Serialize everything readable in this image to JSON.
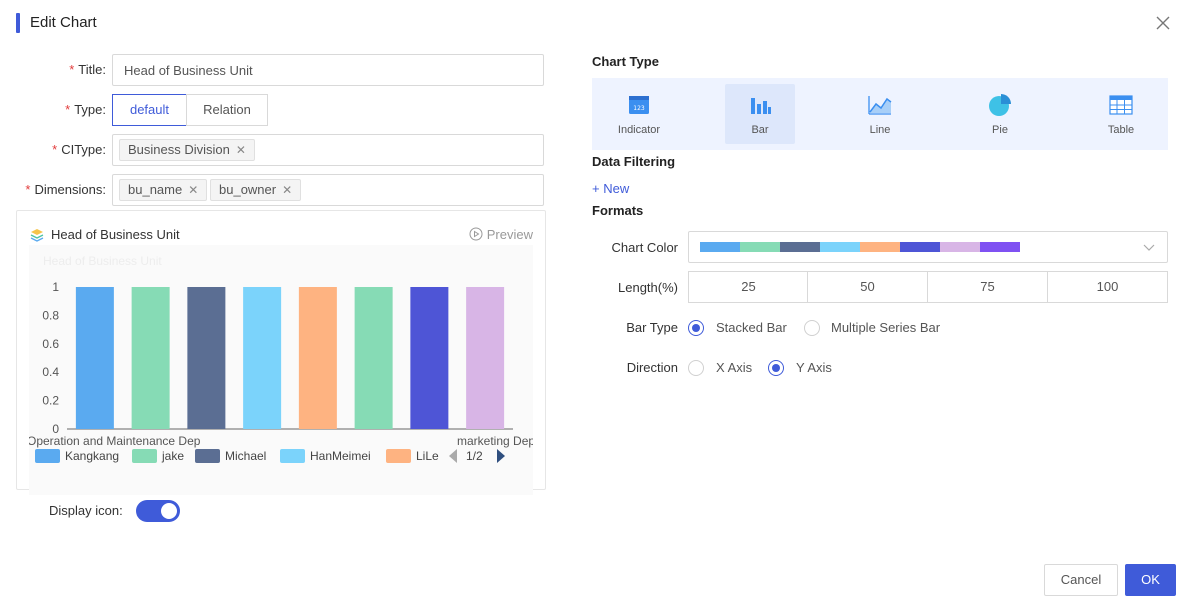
{
  "dialog": {
    "title": "Edit Chart"
  },
  "form": {
    "title_label": "Title",
    "title_value": "Head of Business Unit",
    "type_label": "Type",
    "type_options": [
      "default",
      "Relation"
    ],
    "citype_label": "CIType",
    "citype_tags": [
      "Business Division"
    ],
    "dimensions_label": "Dimensions",
    "dimension_tags": [
      "bu_name",
      "bu_owner"
    ],
    "display_icon_label": "Display icon",
    "display_icon_on": true
  },
  "preview": {
    "title": "Head of Business Unit",
    "preview_label": "Preview"
  },
  "chart_data": {
    "type": "bar",
    "watermark_title": "Head of Business Unit",
    "x_tick_labels": [
      "Operation and Maintenance Dep",
      "marketing Dep"
    ],
    "ylim": [
      0,
      1
    ],
    "yticks": [
      "0",
      "0.2",
      "0.4",
      "0.6",
      "0.8",
      "1"
    ],
    "series": [
      {
        "name": "Kangkang",
        "value": 1,
        "color": "#5aaaf0"
      },
      {
        "name": "jake",
        "value": 1,
        "color": "#86dbb5"
      },
      {
        "name": "Michael",
        "value": 1,
        "color": "#5b6e93"
      },
      {
        "name": "HanMeimei",
        "value": 1,
        "color": "#7bd3fb"
      },
      {
        "name": "LiLei",
        "value": 1,
        "color": "#feb381"
      },
      {
        "name": "",
        "value": 1,
        "color": "#86dbb5"
      },
      {
        "name": "",
        "value": 1,
        "color": "#4e55d6"
      },
      {
        "name": "",
        "value": 1,
        "color": "#d8b5e6"
      }
    ],
    "legend_visible": [
      "Kangkang",
      "jake",
      "Michael",
      "HanMeimei",
      "LiLe"
    ],
    "legend_page": "1/2"
  },
  "right": {
    "chart_type_title": "Chart Type",
    "chart_types": [
      {
        "label": "Indicator",
        "icon": "indicator-icon"
      },
      {
        "label": "Bar",
        "icon": "bar-chart-icon",
        "active": true
      },
      {
        "label": "Line",
        "icon": "line-chart-icon"
      },
      {
        "label": "Pie",
        "icon": "pie-chart-icon"
      },
      {
        "label": "Table",
        "icon": "table-icon"
      }
    ],
    "data_filtering_title": "Data Filtering",
    "new_link": "+ New",
    "formats_title": "Formats",
    "chart_color_label": "Chart Color",
    "palette": [
      "#5aaaf0",
      "#86dbb5",
      "#5b6e93",
      "#7bd3fb",
      "#feb381",
      "#4e55d6",
      "#d8b5e6",
      "#7f51f2"
    ],
    "length_label": "Length(%)",
    "length_options": [
      "25",
      "50",
      "75",
      "100"
    ],
    "bar_type_label": "Bar Type",
    "bar_type_options": [
      "Stacked Bar",
      "Multiple Series Bar"
    ],
    "bar_type_selected": "Stacked Bar",
    "direction_label": "Direction",
    "direction_options": [
      "X Axis",
      "Y Axis"
    ],
    "direction_selected": "Y Axis"
  },
  "footer": {
    "cancel": "Cancel",
    "ok": "OK"
  },
  "colors": {
    "accent": "#3f5bd9",
    "required": "#e23b3b"
  }
}
